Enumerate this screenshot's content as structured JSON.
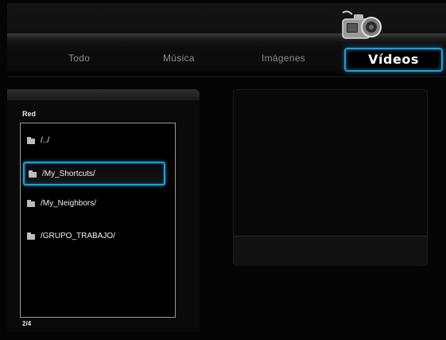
{
  "tabs": [
    {
      "label": "Todo"
    },
    {
      "label": "Música"
    },
    {
      "label": "Imágenes"
    },
    {
      "label": "Vídeos"
    }
  ],
  "active_tab": "Vídeos",
  "browser": {
    "source_label": "Red",
    "items": [
      {
        "label": "/../",
        "icon": "folder-icon"
      },
      {
        "label": "/My_Shortcuts/",
        "icon": "folder-icon"
      },
      {
        "label": "/My_Neighbors/",
        "icon": "folder-icon"
      },
      {
        "label": "/GRUPO_TRABAJO/",
        "icon": "folder-icon"
      }
    ],
    "selected_index": 1,
    "page_indicator": "2/4"
  },
  "colors": {
    "accent": "#1f9fd6",
    "background": "#050505",
    "text": "#f0f0f0",
    "inactive_tab": "#8c8c8c"
  },
  "header_icon": "video-camera-icon"
}
